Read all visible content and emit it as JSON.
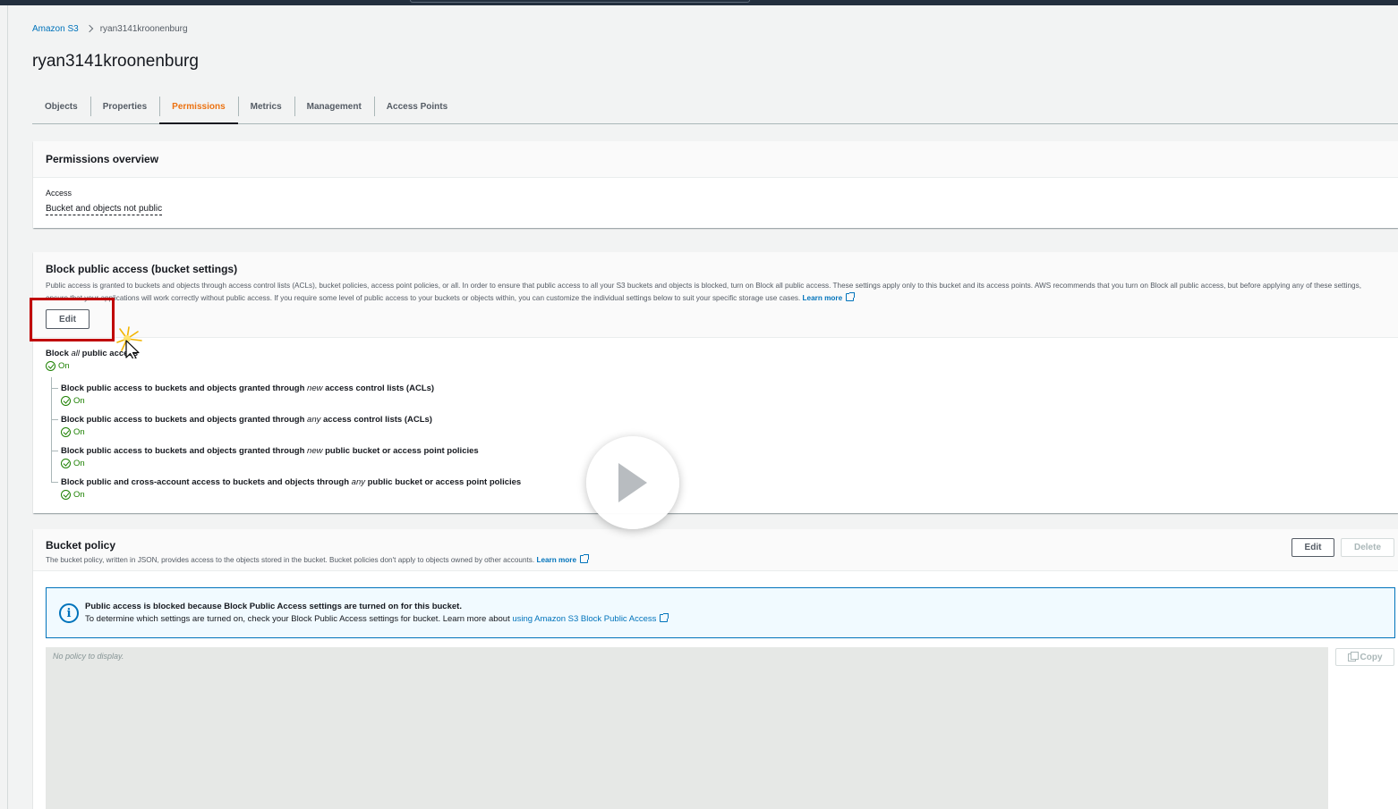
{
  "breadcrumb": {
    "root": "Amazon S3",
    "current": "ryan3141kroonenburg"
  },
  "page": {
    "title": "ryan3141kroonenburg"
  },
  "tabs": [
    {
      "label": "Objects"
    },
    {
      "label": "Properties"
    },
    {
      "label": "Permissions",
      "active": true
    },
    {
      "label": "Metrics"
    },
    {
      "label": "Management"
    },
    {
      "label": "Access Points"
    }
  ],
  "overview": {
    "title": "Permissions overview",
    "access_label": "Access",
    "access_value": "Bucket and objects not public"
  },
  "block_public_access": {
    "title": "Block public access (bucket settings)",
    "description": "Public access is granted to buckets and objects through access control lists (ACLs), bucket policies, access point policies, or all. In order to ensure that public access to all your S3 buckets and objects is blocked, turn on Block all public access. These settings apply only to this bucket and its access points. AWS recommends that you turn on Block all public access, but before applying any of these settings, ensure that your applications will work correctly without public access. If you require some level of public access to your buckets or objects within, you can customize the individual settings below to suit your specific storage use cases.",
    "learn_more": "Learn more",
    "edit_label": "Edit",
    "main_setting": {
      "pre": "Block ",
      "em": "all",
      "post": " public access",
      "status": "On"
    },
    "settings": [
      {
        "pre": "Block public access to buckets and objects granted through ",
        "em": "new",
        "post": " access control lists (ACLs)",
        "status": "On"
      },
      {
        "pre": "Block public access to buckets and objects granted through ",
        "em": "any",
        "post": " access control lists (ACLs)",
        "status": "On"
      },
      {
        "pre": "Block public access to buckets and objects granted through ",
        "em": "new",
        "post": " public bucket or access point policies",
        "status": "On"
      },
      {
        "pre": "Block public and cross-account access to buckets and objects through ",
        "em": "any",
        "post": " public bucket or access point policies",
        "status": "On"
      }
    ]
  },
  "bucket_policy": {
    "title": "Bucket policy",
    "description": "The bucket policy, written in JSON, provides access to the objects stored in the bucket. Bucket policies don't apply to objects owned by other accounts.",
    "learn_more": "Learn more",
    "edit_label": "Edit",
    "delete_label": "Delete",
    "alert_title": "Public access is blocked because Block Public Access settings are turned on for this bucket.",
    "alert_text": "To determine which settings are turned on, check your Block Public Access settings for bucket. Learn more about",
    "alert_link": "using Amazon S3 Block Public Access",
    "empty_text": "No policy to display.",
    "copy_label": "Copy"
  },
  "colors": {
    "accent_tab": "#ec7211",
    "link": "#0073bb",
    "success": "#1d8102",
    "highlight": "#c00000"
  }
}
